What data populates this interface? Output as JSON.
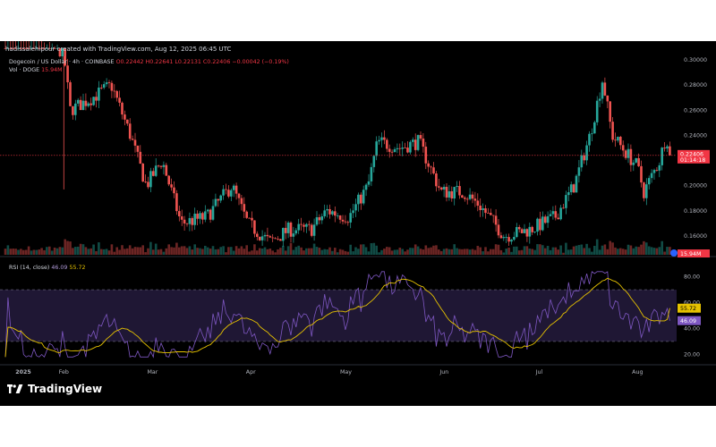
{
  "credit": "hadissalehipour created with TradingView.com, Aug 12, 2025 06:45 UTC",
  "header": {
    "symbol": "Dogecoin / US Dollar · 4h · COINBASE",
    "ohlc": "O0.22442 H0.22641 L0.22131 C0.22406 −0.00042 (−0.19%)",
    "vol_label": "Vol · DOGE",
    "vol_value": "15.94M"
  },
  "rsi_label": {
    "name": "RSI (14, close)",
    "rsi_value": "46.09",
    "ma_value": "55.72"
  },
  "brand": "TradingView",
  "colors": {
    "background": "#000000",
    "up": "#26a69a",
    "down": "#ef5350",
    "price_tag": "#f23645",
    "rsi_line": "#7e57c2",
    "rsi_ma": "#e6c200",
    "rsi_band": "#2a1f45"
  },
  "chart_data": [
    {
      "type": "candlestick",
      "title": "Dogecoin / US Dollar · 4h · COINBASE",
      "x_ticks": [
        "2025",
        "Feb",
        "Mar",
        "Apr",
        "May",
        "Jun",
        "Jul",
        "Aug"
      ],
      "y_ticks": [
        "0.30000",
        "0.28000",
        "0.26000",
        "0.24000",
        "0.22000",
        "0.20000",
        "0.18000",
        "0.16000"
      ],
      "ylim": [
        0.145,
        0.305
      ],
      "scale": "linear",
      "last_price": 0.22406,
      "last_price_label": "0.22406",
      "countdown_label": "01:14:18",
      "volume_label": "15.94M",
      "approx_close_path": [
        {
          "date": "2025-01-13",
          "close": 0.35
        },
        {
          "date": "2025-02-01",
          "close": 0.305
        },
        {
          "date": "2025-02-03",
          "close": 0.26
        },
        {
          "date": "2025-02-10",
          "close": 0.27
        },
        {
          "date": "2025-02-16",
          "close": 0.28
        },
        {
          "date": "2025-02-22",
          "close": 0.24
        },
        {
          "date": "2025-02-27",
          "close": 0.2
        },
        {
          "date": "2025-03-04",
          "close": 0.22
        },
        {
          "date": "2025-03-10",
          "close": 0.17
        },
        {
          "date": "2025-03-18",
          "close": 0.175
        },
        {
          "date": "2025-03-26",
          "close": 0.2
        },
        {
          "date": "2025-03-31",
          "close": 0.17
        },
        {
          "date": "2025-04-07",
          "close": 0.155
        },
        {
          "date": "2025-04-13",
          "close": 0.165
        },
        {
          "date": "2025-04-20",
          "close": 0.165
        },
        {
          "date": "2025-04-25",
          "close": 0.18
        },
        {
          "date": "2025-05-02",
          "close": 0.175
        },
        {
          "date": "2025-05-08",
          "close": 0.2
        },
        {
          "date": "2025-05-11",
          "close": 0.235
        },
        {
          "date": "2025-05-18",
          "close": 0.23
        },
        {
          "date": "2025-05-24",
          "close": 0.235
        },
        {
          "date": "2025-05-31",
          "close": 0.195
        },
        {
          "date": "2025-06-07",
          "close": 0.195
        },
        {
          "date": "2025-06-12",
          "close": 0.185
        },
        {
          "date": "2025-06-20",
          "close": 0.16
        },
        {
          "date": "2025-06-28",
          "close": 0.165
        },
        {
          "date": "2025-07-06",
          "close": 0.175
        },
        {
          "date": "2025-07-12",
          "close": 0.2
        },
        {
          "date": "2025-07-17",
          "close": 0.24
        },
        {
          "date": "2025-07-21",
          "close": 0.285
        },
        {
          "date": "2025-07-24",
          "close": 0.24
        },
        {
          "date": "2025-08-01",
          "close": 0.215
        },
        {
          "date": "2025-08-03",
          "close": 0.195
        },
        {
          "date": "2025-08-08",
          "close": 0.22
        },
        {
          "date": "2025-08-10",
          "close": 0.24
        },
        {
          "date": "2025-08-12",
          "close": 0.22406
        }
      ]
    },
    {
      "type": "line",
      "title": "RSI (14, close)",
      "y_ticks": [
        "80.00",
        "60.00",
        "40.00",
        "20.00"
      ],
      "ylim": [
        12,
        88
      ],
      "bands": [
        70,
        30
      ],
      "series": [
        {
          "name": "RSI",
          "last_value": 46.09,
          "last_label": "46.09"
        },
        {
          "name": "MA",
          "last_value": 55.72,
          "last_label": "55.72"
        }
      ]
    }
  ]
}
